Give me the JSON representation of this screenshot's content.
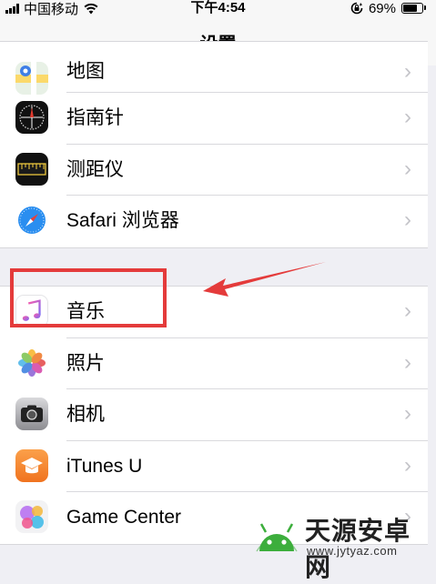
{
  "status_bar": {
    "carrier": "中国移动",
    "time": "下午4:54",
    "battery": "69%",
    "battery_level": 0.69,
    "icons": [
      "signal-icon",
      "wifi-icon",
      "orientation-lock-icon",
      "battery-icon"
    ]
  },
  "nav": {
    "title": "设置"
  },
  "group_top": {
    "items": [
      {
        "label": "地图",
        "icon": "maps-icon"
      },
      {
        "label": "指南针",
        "icon": "compass-icon"
      },
      {
        "label": "测距仪",
        "icon": "measure-icon"
      },
      {
        "label": "Safari 浏览器",
        "icon": "safari-icon"
      }
    ]
  },
  "group_media": {
    "items": [
      {
        "label": "音乐",
        "icon": "music-icon"
      },
      {
        "label": "照片",
        "icon": "photos-icon"
      },
      {
        "label": "相机",
        "icon": "camera-icon"
      },
      {
        "label": "iTunes U",
        "icon": "itunes-u-icon"
      },
      {
        "label": "Game Center",
        "icon": "game-center-icon"
      }
    ]
  },
  "chevron": "›",
  "annotation": {
    "color": "#e43b3b"
  },
  "watermark": {
    "cn": "天源安卓网",
    "url": "www.jytyaz.com"
  }
}
